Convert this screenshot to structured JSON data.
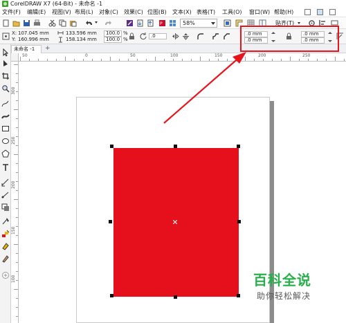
{
  "window": {
    "title": "CorelDRAW X7 (64-Bit) - 未命名 -1"
  },
  "menu": {
    "items": [
      {
        "label": "文件(F)"
      },
      {
        "label": "编辑(E)"
      },
      {
        "label": "视图(V)"
      },
      {
        "label": "布局(L)"
      },
      {
        "label": "对象(C)"
      },
      {
        "label": "效果(C)"
      },
      {
        "label": "位图(B)"
      },
      {
        "label": "文本(X)"
      },
      {
        "label": "表格(T)"
      },
      {
        "label": "工具(O)"
      },
      {
        "label": "窗口(W)"
      },
      {
        "label": "帮助(H)"
      }
    ]
  },
  "toolbar": {
    "zoom_value": "58%",
    "snap_label": "贴齐(T)"
  },
  "property_bar": {
    "x": "107.045 mm",
    "y": "160.996 mm",
    "width": "133.596 mm",
    "height": "158.134 mm",
    "scale_w": "100.0",
    "scale_h": "100.0",
    "percent": "%",
    "rotation": ".0",
    "corner_tl": ".0 mm",
    "corner_bl": ".0 mm",
    "corner_tr": ".0 mm",
    "corner_br": ".0 mm"
  },
  "document": {
    "tab_label": "未命名 -1",
    "add_tab": "+"
  },
  "hruler": {
    "labels": [
      "50",
      "0",
      "50",
      "100",
      "150",
      "200",
      "250"
    ]
  },
  "vruler": {
    "labels": [
      "300",
      "250",
      "200",
      "150",
      "100"
    ]
  },
  "colors": {
    "shape_fill": "#e5101b",
    "annotation": "#e8141c",
    "watermark_green": "#27b04a"
  },
  "watermark": {
    "title": "百科全说",
    "subtitle": "助你轻松解决"
  }
}
